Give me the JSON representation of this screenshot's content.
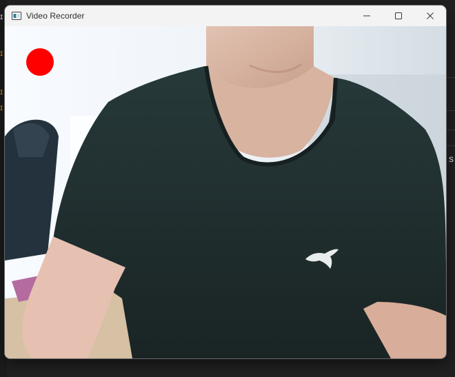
{
  "window": {
    "title": "Video Recorder",
    "app_icon": "window-app-icon",
    "controls": [
      "minimize-icon",
      "maximize-icon",
      "close-icon"
    ]
  },
  "video": {
    "recording_indicator_color": "#ff0000",
    "brand_logo": "puma-logo"
  },
  "colors": {
    "titlebar": "#f3f3f3",
    "shirt": "#1e2a2a",
    "wall": "#e9eef2"
  }
}
